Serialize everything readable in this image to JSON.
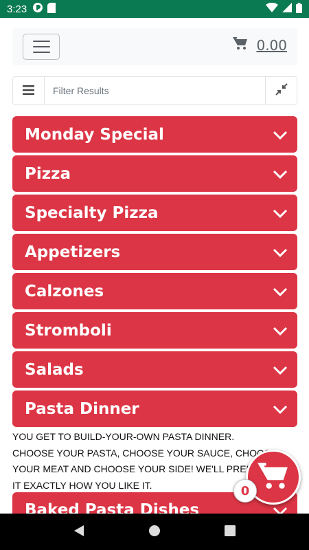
{
  "status_bar": {
    "time": "3:23",
    "icons": [
      "notification-app-icon",
      "sd-card-icon",
      "wifi-icon",
      "signal-icon",
      "battery-icon"
    ]
  },
  "navbar": {
    "menu_icon": "hamburger-icon",
    "cart_icon": "cart-icon",
    "cart_total": "0.00"
  },
  "filter": {
    "placeholder": "Filter Results",
    "left_icon": "list-icon",
    "right_icon": "collapse-arrows-icon"
  },
  "categories": [
    {
      "label": "Monday Special"
    },
    {
      "label": "Pizza"
    },
    {
      "label": "Specialty Pizza"
    },
    {
      "label": "Appetizers"
    },
    {
      "label": "Calzones"
    },
    {
      "label": "Stromboli"
    },
    {
      "label": "Salads"
    },
    {
      "label": "Pasta Dinner"
    },
    {
      "label": "Baked Pasta Dishes"
    }
  ],
  "pasta_dinner_description": {
    "line1": "YOU GET TO BUILD-YOUR-OWN PASTA DINNER.",
    "line2": "CHOOSE YOUR PASTA, CHOOSE YOUR SAUCE, CHOOSE",
    "line3": "YOUR MEAT AND CHOOSE YOUR SIDE! WE'LL PREPARE",
    "line4": "IT EXACTLY HOW YOU LIKE IT."
  },
  "floating_cart": {
    "icon": "cart-icon",
    "count": "0"
  },
  "colors": {
    "accent": "#dc3545",
    "status_bar": "#0a7a52",
    "navbar_bg": "#f8f9fa"
  }
}
